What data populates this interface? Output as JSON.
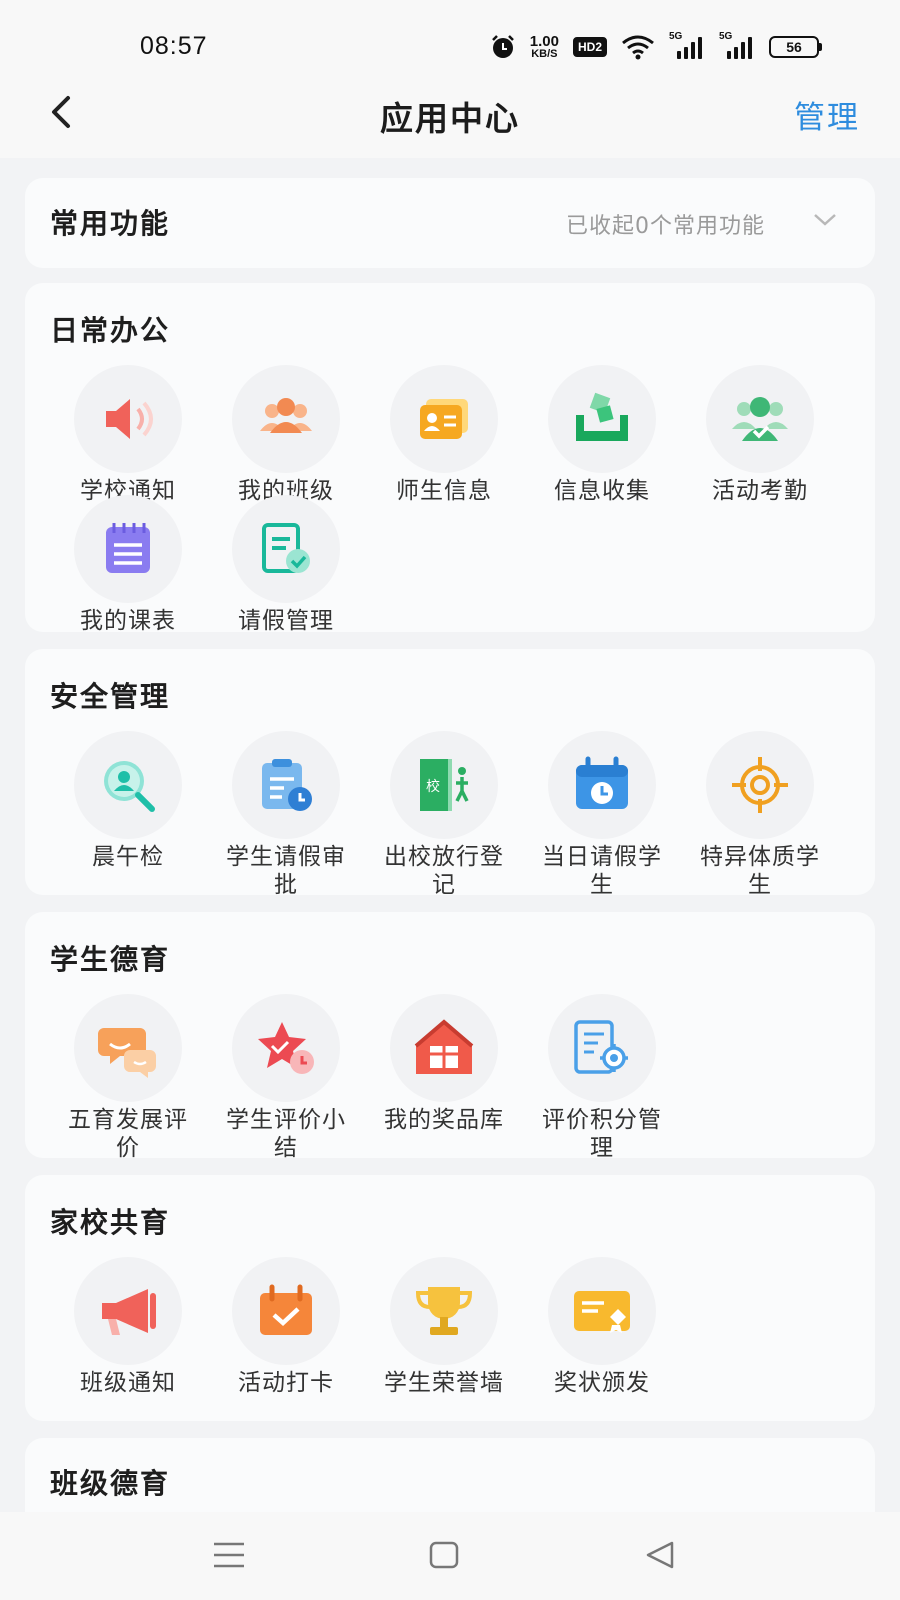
{
  "status": {
    "time": "08:57",
    "speed_value": "1.00",
    "speed_unit": "KB/S",
    "hd": "HD2",
    "sig1": "5G",
    "sig2": "5G",
    "battery": "56"
  },
  "header": {
    "title": "应用中心",
    "manage": "管理",
    "back_icon": "chevron-left-icon"
  },
  "common": {
    "title": "常用功能",
    "collapse_text": "已收起0个常用功能"
  },
  "sections": [
    {
      "title": "日常办公",
      "apps": [
        {
          "label": "学校通知",
          "icon": "speaker-icon"
        },
        {
          "label": "我的班级",
          "icon": "people-icon"
        },
        {
          "label": "师生信息",
          "icon": "id-card-icon"
        },
        {
          "label": "信息收集",
          "icon": "inbox-icon"
        },
        {
          "label": "活动考勤",
          "icon": "attendance-icon"
        },
        {
          "label": "我的课表",
          "icon": "notebook-icon"
        },
        {
          "label": "请假管理",
          "icon": "leave-form-icon"
        }
      ]
    },
    {
      "title": "安全管理",
      "apps": [
        {
          "label": "晨午检",
          "icon": "magnifier-user-icon"
        },
        {
          "label": "学生请假审批",
          "icon": "clipboard-clock-icon"
        },
        {
          "label": "出校放行登记",
          "icon": "exit-door-icon"
        },
        {
          "label": "当日请假学生",
          "icon": "calendar-clock-icon"
        },
        {
          "label": "特异体质学生",
          "icon": "crosshair-icon"
        }
      ]
    },
    {
      "title": "学生德育",
      "apps": [
        {
          "label": "五育发展评价",
          "icon": "chat-bubbles-icon"
        },
        {
          "label": "学生评价小结",
          "icon": "star-clock-icon"
        },
        {
          "label": "我的奖品库",
          "icon": "gift-house-icon"
        },
        {
          "label": "评价积分管理",
          "icon": "settings-doc-icon"
        }
      ]
    },
    {
      "title": "家校共育",
      "apps": [
        {
          "label": "班级通知",
          "icon": "megaphone-icon"
        },
        {
          "label": "活动打卡",
          "icon": "calendar-check-icon"
        },
        {
          "label": "学生荣誉墙",
          "icon": "trophy-icon"
        },
        {
          "label": "奖状颁发",
          "icon": "certificate-icon"
        }
      ]
    },
    {
      "title": "班级德育",
      "apps": []
    }
  ]
}
